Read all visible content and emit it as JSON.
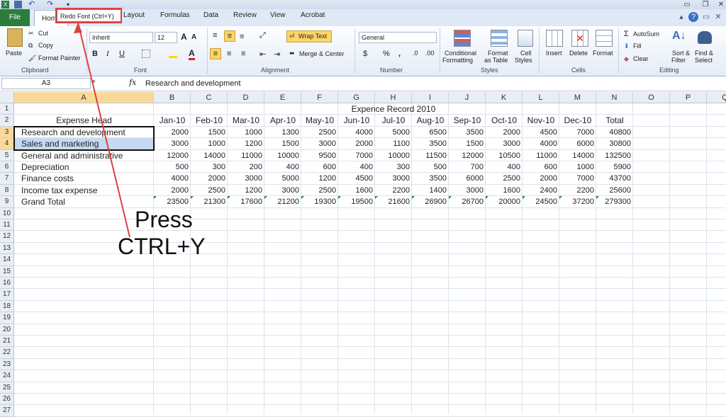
{
  "tooltip": "Redo Font (Ctrl+Y)",
  "tabs": {
    "file": "File",
    "home": "Home",
    "layout": "Layout",
    "formulas": "Formulas",
    "data": "Data",
    "review": "Review",
    "view": "View",
    "acrobat": "Acrobat"
  },
  "clipboard": {
    "paste": "Paste",
    "cut": "Cut",
    "copy": "Copy",
    "format_painter": "Format Painter",
    "label": "Clipboard"
  },
  "font": {
    "name": "Inherit",
    "size": "12",
    "label": "Font"
  },
  "alignment": {
    "wrap_text": "Wrap Text",
    "merge_center": "Merge & Center",
    "label": "Alignment"
  },
  "number": {
    "format": "General",
    "label": "Number"
  },
  "styles": {
    "conditional": "Conditional",
    "conditional2": "Formatting",
    "format_table": "Format",
    "format_table2": "as Table",
    "cell_styles": "Cell",
    "cell_styles2": "Styles",
    "label": "Styles"
  },
  "cells": {
    "insert": "Insert",
    "delete": "Delete",
    "format": "Format",
    "label": "Cells"
  },
  "editing": {
    "autosum": "AutoSum",
    "fill": "Fill",
    "clear": "Clear",
    "sort": "Sort &",
    "sort2": "Filter",
    "find": "Find &",
    "find2": "Select",
    "label": "Editing"
  },
  "formula_bar": {
    "name_box": "A3",
    "fx": "fx",
    "content": "Research and development"
  },
  "columns": [
    "A",
    "B",
    "C",
    "D",
    "E",
    "F",
    "G",
    "H",
    "I",
    "J",
    "K",
    "L",
    "M",
    "N",
    "O",
    "P",
    "Q"
  ],
  "rows": [
    "1",
    "2",
    "3",
    "4",
    "5",
    "6",
    "7",
    "8",
    "9",
    "10",
    "11",
    "12",
    "13",
    "14",
    "15",
    "16",
    "17",
    "18",
    "19",
    "20",
    "21",
    "22",
    "23",
    "24",
    "25",
    "26",
    "27"
  ],
  "sheet": {
    "title": "Expence Record 2010",
    "header": [
      "Expense Head",
      "Jan-10",
      "Feb-10",
      "Mar-10",
      "Apr-10",
      "May-10",
      "Jun-10",
      "Jul-10",
      "Aug-10",
      "Sep-10",
      "Oct-10",
      "Nov-10",
      "Dec-10",
      "Total"
    ],
    "data": [
      [
        "Research and development",
        "2000",
        "1500",
        "1000",
        "1300",
        "2500",
        "4000",
        "5000",
        "6500",
        "3500",
        "2000",
        "4500",
        "7000",
        "40800"
      ],
      [
        "Sales and marketing",
        "3000",
        "1000",
        "1200",
        "1500",
        "3000",
        "2000",
        "1100",
        "3500",
        "1500",
        "3000",
        "4000",
        "6000",
        "30800"
      ],
      [
        "General and administrative",
        "12000",
        "14000",
        "11000",
        "10000",
        "9500",
        "7000",
        "10000",
        "11500",
        "12000",
        "10500",
        "11000",
        "14000",
        "132500"
      ],
      [
        "Depreciation",
        "500",
        "300",
        "200",
        "400",
        "600",
        "400",
        "300",
        "500",
        "700",
        "400",
        "600",
        "1000",
        "5900"
      ],
      [
        "Finance costs",
        "4000",
        "2000",
        "3000",
        "5000",
        "1200",
        "4500",
        "3000",
        "3500",
        "6000",
        "2500",
        "2000",
        "7000",
        "43700"
      ],
      [
        "Income tax expense",
        "2000",
        "2500",
        "1200",
        "3000",
        "2500",
        "1600",
        "2200",
        "1400",
        "3000",
        "1600",
        "2400",
        "2200",
        "25600"
      ],
      [
        "Grand Total",
        "23500",
        "21300",
        "17600",
        "21200",
        "19300",
        "19500",
        "21600",
        "26900",
        "26700",
        "20000",
        "24500",
        "37200",
        "279300"
      ]
    ]
  },
  "annotation": {
    "line1": "Press",
    "line2": "CTRL+Y"
  },
  "colors": {
    "file_tab": "#2b7d3d",
    "selection": "#c5d9f1",
    "annotation_red": "#e04040"
  }
}
